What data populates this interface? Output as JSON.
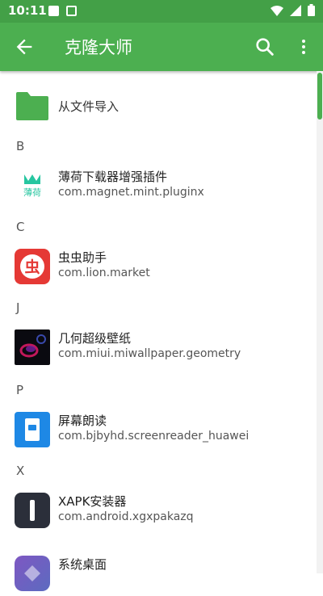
{
  "status_bar": {
    "time": "10:11"
  },
  "app_bar": {
    "title": "克隆大师"
  },
  "import_item": {
    "label": "从文件导入"
  },
  "sections": [
    {
      "letter": "B",
      "apps": [
        {
          "name": "薄荷下载器增强插件",
          "package": "com.magnet.mint.pluginx",
          "icon_text": "薄荷"
        }
      ]
    },
    {
      "letter": "C",
      "apps": [
        {
          "name": "虫虫助手",
          "package": "com.lion.market",
          "icon_text": "虫"
        }
      ]
    },
    {
      "letter": "J",
      "apps": [
        {
          "name": "几何超级壁纸",
          "package": "com.miui.miwallpaper.geometry"
        }
      ]
    },
    {
      "letter": "P",
      "apps": [
        {
          "name": "屏幕朗读",
          "package": "com.bjbyhd.screenreader_huawei"
        }
      ]
    },
    {
      "letter": "X",
      "apps": [
        {
          "name": "XAPK安装器",
          "package": "com.android.xgxpakazq"
        },
        {
          "name": "系统桌面",
          "package": ""
        }
      ]
    }
  ],
  "colors": {
    "primary": "#4caf50",
    "status": "#43a047",
    "accent_red": "#e53935"
  }
}
